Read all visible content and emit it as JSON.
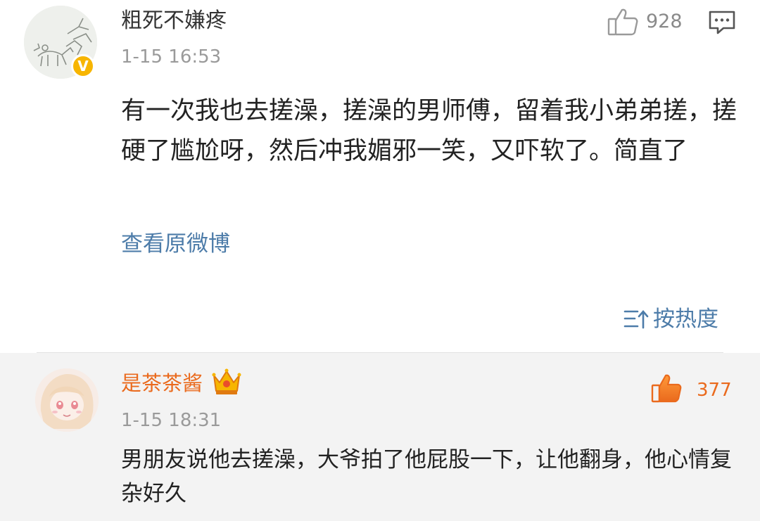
{
  "comment1": {
    "username": "粗死不嫌疼",
    "timestamp": "1-15 16:53",
    "like_count": "928",
    "text": "有一次我也去搓澡，搓澡的男师傅，留着我小弟弟搓，搓硬了尴尬呀，然后冲我媚邪一笑，又吓软了。简直了",
    "view_original_label": "查看原微博",
    "verified_badge": "V",
    "icons": [
      "thumbs-up-icon",
      "comment-reply-icon",
      "verified-badge-icon"
    ]
  },
  "sort": {
    "label": "按热度",
    "icon": "sort-icon"
  },
  "comment2": {
    "username": "是茶茶酱",
    "timestamp": "1-15 18:31",
    "like_count": "377",
    "text": "男朋友说他去搓澡，大爷拍了他屁股一下，让他翻身，他心情复杂好久",
    "icons": [
      "crown-vip-icon",
      "thumbs-up-filled-icon"
    ]
  },
  "colors": {
    "link_blue": "#4d7ca9",
    "vip_orange": "#ea6a1d",
    "verified_yellow": "#f7b500",
    "meta_gray": "#9a9a9a",
    "panel_bg": "#f3f3f3"
  }
}
